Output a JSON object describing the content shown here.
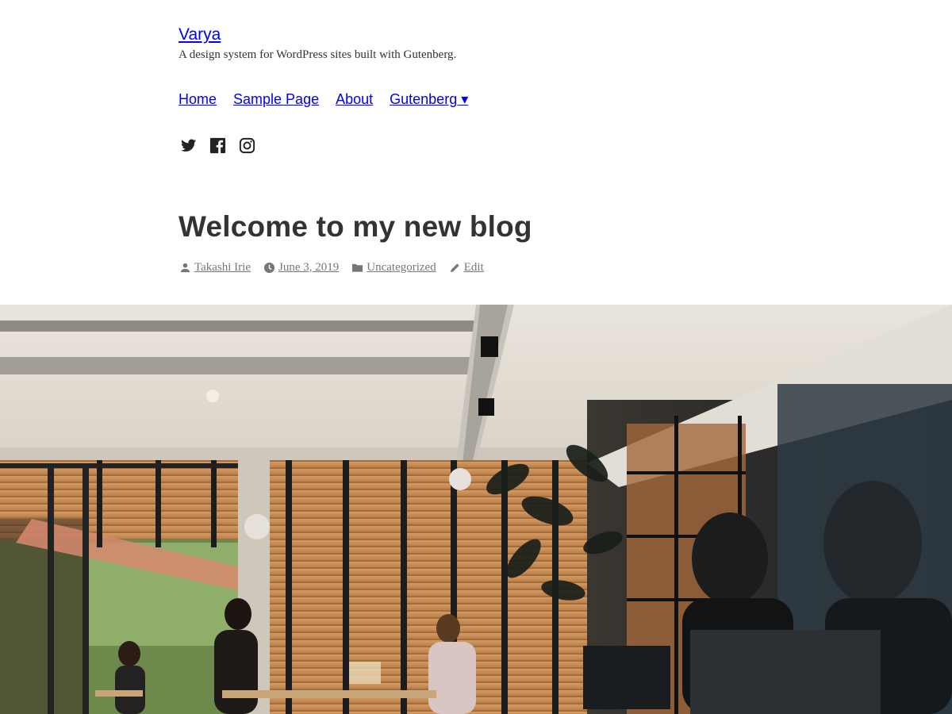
{
  "site": {
    "title": "Varya",
    "description": "A design system for WordPress sites built with Gutenberg."
  },
  "nav": {
    "items": [
      {
        "label": "Home"
      },
      {
        "label": "Sample Page"
      },
      {
        "label": "About"
      },
      {
        "label": "Gutenberg ▾"
      }
    ]
  },
  "social": {
    "icons": [
      "twitter-icon",
      "facebook-icon",
      "instagram-icon"
    ]
  },
  "post": {
    "title": "Welcome to my new blog",
    "author": "Takashi Irie",
    "date": "June 3, 2019",
    "category": "Uncategorized",
    "edit": "Edit"
  },
  "colors": {
    "link": "#0000ee",
    "text": "#333333",
    "meta": "#767676"
  }
}
